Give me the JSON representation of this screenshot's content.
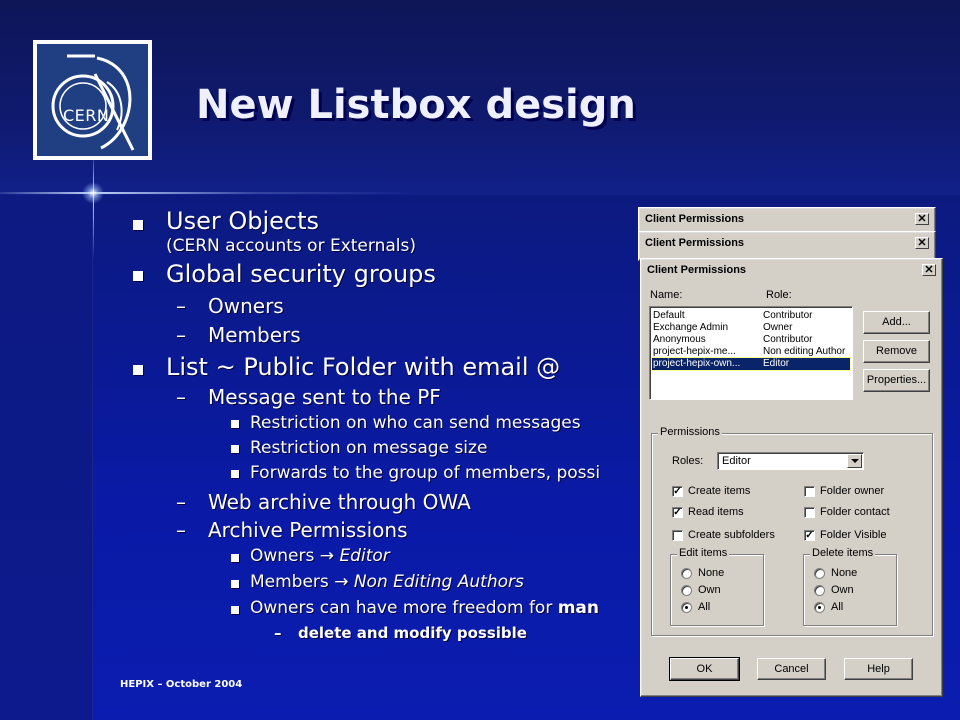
{
  "slide": {
    "title": "New Listbox design",
    "footer": "HEPIX – October 2004",
    "logo_text": "CERN"
  },
  "bullets": {
    "b1": "User Objects",
    "b1_sub": "(CERN accounts or Externals)",
    "b2": "Global security groups",
    "b2_1": "Owners",
    "b2_2": "Members",
    "b3": "List ~ Public Folder with email @",
    "b3_1": "Message sent to the PF",
    "b3_1_1": "Restriction on who can send messages",
    "b3_1_2": "Restriction on message size",
    "b3_1_3": "Forwards to the group of members, possi",
    "b3_2": "Web archive through OWA",
    "b3_3": "Archive Permissions",
    "b3_3_1a": "Owners ",
    "b3_3_1b": "Editor",
    "b3_3_2a": "Members ",
    "b3_3_2b": "Non Editing Authors",
    "b3_3_3a": "Owners can have more freedom for ",
    "b3_3_3b": "man",
    "b3_3_3_1": "delete and modify possible",
    "dash": "–",
    "arrow": "→"
  },
  "dialogs": {
    "back_title_1": "Client Permissions",
    "back_title_2": "Client Permissions",
    "front": {
      "title": "Client Permissions",
      "name_label": "Name:",
      "role_label": "Role:",
      "rows": [
        {
          "name": "Default",
          "role": "Contributor"
        },
        {
          "name": "Exchange Admin",
          "role": "Owner"
        },
        {
          "name": "Anonymous",
          "role": "Contributor"
        },
        {
          "name": "project-hepix-me...",
          "role": "Non editing Author"
        },
        {
          "name": "project-hepix-own...",
          "role": "Editor"
        }
      ],
      "add_button": "Add...",
      "remove_button": "Remove",
      "properties_button": "Properties...",
      "permissions_group": "Permissions",
      "roles_label": "Roles:",
      "roles_value": "Editor",
      "checks": {
        "create_items": "Create items",
        "read_items": "Read items",
        "create_subfolders": "Create subfolders",
        "folder_owner": "Folder owner",
        "folder_contact": "Folder contact",
        "folder_visible": "Folder Visible"
      },
      "edit_items_group": "Edit items",
      "delete_items_group": "Delete items",
      "radio_none": "None",
      "radio_own": "Own",
      "radio_all": "All",
      "ok_button": "OK",
      "cancel_button": "Cancel",
      "help_button": "Help",
      "close_glyph": "✕",
      "check_glyph": "✓"
    }
  },
  "colors": {
    "background": "#0b1a96",
    "selection": "#0a246a",
    "dialog_face": "#d4d0c8"
  }
}
